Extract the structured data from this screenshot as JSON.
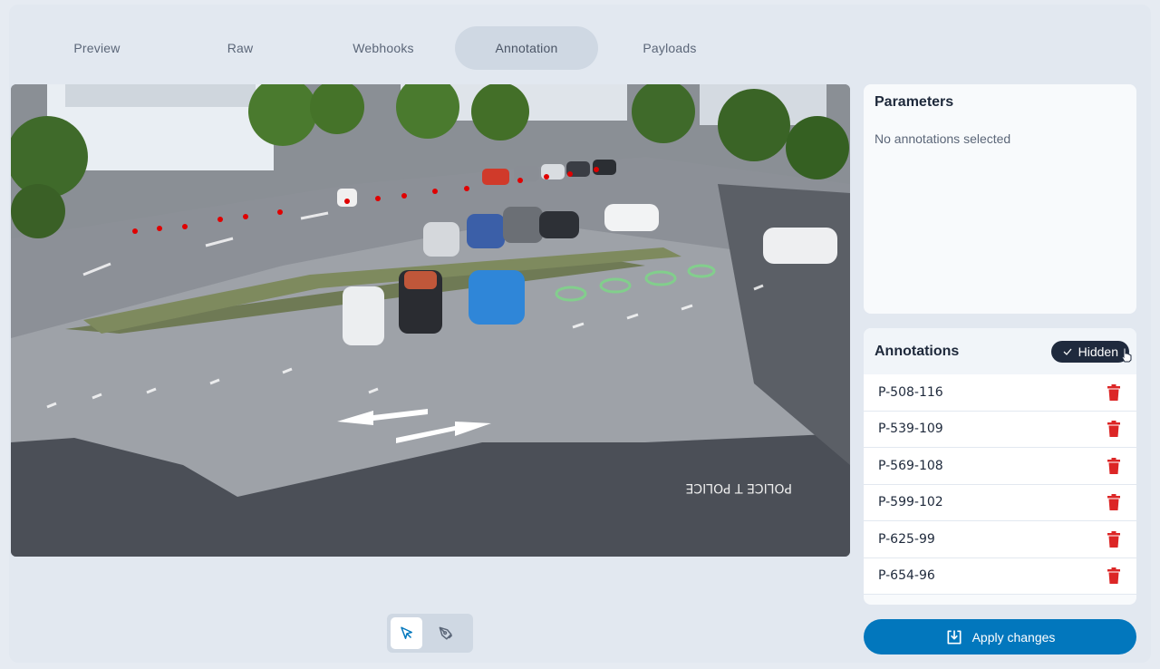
{
  "tabs": [
    {
      "label": "Preview"
    },
    {
      "label": "Raw"
    },
    {
      "label": "Webhooks"
    },
    {
      "label": "Annotation",
      "active": true
    },
    {
      "label": "Payloads"
    }
  ],
  "parameters": {
    "title": "Parameters",
    "empty_text": "No annotations selected"
  },
  "annotations": {
    "title": "Annotations",
    "toggle_label": "Hidden",
    "items": [
      {
        "label": "P-508-116"
      },
      {
        "label": "P-539-109"
      },
      {
        "label": "P-569-108"
      },
      {
        "label": "P-599-102"
      },
      {
        "label": "P-625-99"
      },
      {
        "label": "P-654-96"
      }
    ]
  },
  "tools": [
    {
      "name": "select-tool",
      "icon": "cursor-arrow-icon",
      "active": true
    },
    {
      "name": "draw-tool",
      "icon": "pen-icon",
      "active": false
    }
  ],
  "apply_button": {
    "label": "Apply changes",
    "icon": "download-tray-icon"
  },
  "colors": {
    "accent": "#0277bd",
    "tab_active_bg": "#cfd8e3",
    "danger": "#dc2626",
    "dark_pill": "#1f2a3d",
    "annotation_point": "#e00000"
  }
}
